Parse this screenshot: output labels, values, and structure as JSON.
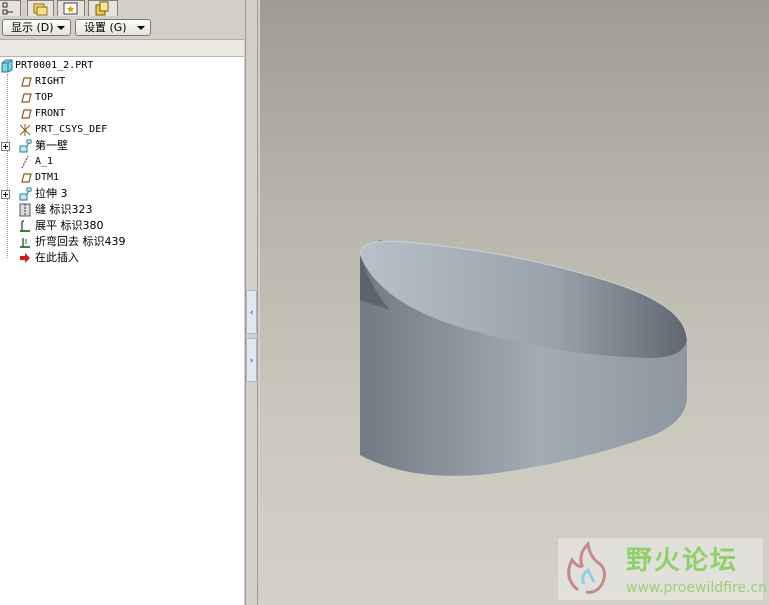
{
  "toolbar": {
    "show_label": "显示 (D)",
    "settings_label": "设置 (G)"
  },
  "tabs": [
    {
      "name": "model-tree-tab"
    },
    {
      "name": "folder-browser-tab"
    },
    {
      "name": "favorites-tab"
    },
    {
      "name": "connections-tab"
    }
  ],
  "tree": {
    "root": "PRT0001_2.PRT",
    "items": [
      {
        "label": "RIGHT",
        "icon": "datum-plane-icon"
      },
      {
        "label": "TOP",
        "icon": "datum-plane-icon"
      },
      {
        "label": "FRONT",
        "icon": "datum-plane-icon"
      },
      {
        "label": "PRT_CSYS_DEF",
        "icon": "csys-icon"
      },
      {
        "label": "第一壁",
        "icon": "first-wall-icon"
      },
      {
        "label": "A_1",
        "icon": "datum-axis-icon"
      },
      {
        "label": "DTM1",
        "icon": "datum-plane-icon"
      },
      {
        "label": "拉伸 3",
        "icon": "extrude-icon"
      },
      {
        "label": "缝 标识323",
        "icon": "rip-icon"
      },
      {
        "label": "展平 标识380",
        "icon": "unbend-icon"
      },
      {
        "label": "折弯回去 标识439",
        "icon": "bend-back-icon"
      },
      {
        "label": "在此插入",
        "icon": "insert-here-icon"
      }
    ]
  },
  "splitter": {
    "collapse_glyph": "‹",
    "expand_glyph": "›"
  },
  "watermark": {
    "title": "野火论坛",
    "url": "www.proewildfire.cn"
  },
  "colors": {
    "viewport_top": "#9f9c94",
    "viewport_bottom": "#d4d1c8",
    "model_dark": "#6f7880",
    "model_light": "#a3adb5",
    "watermark_green": "#8ed16a"
  }
}
